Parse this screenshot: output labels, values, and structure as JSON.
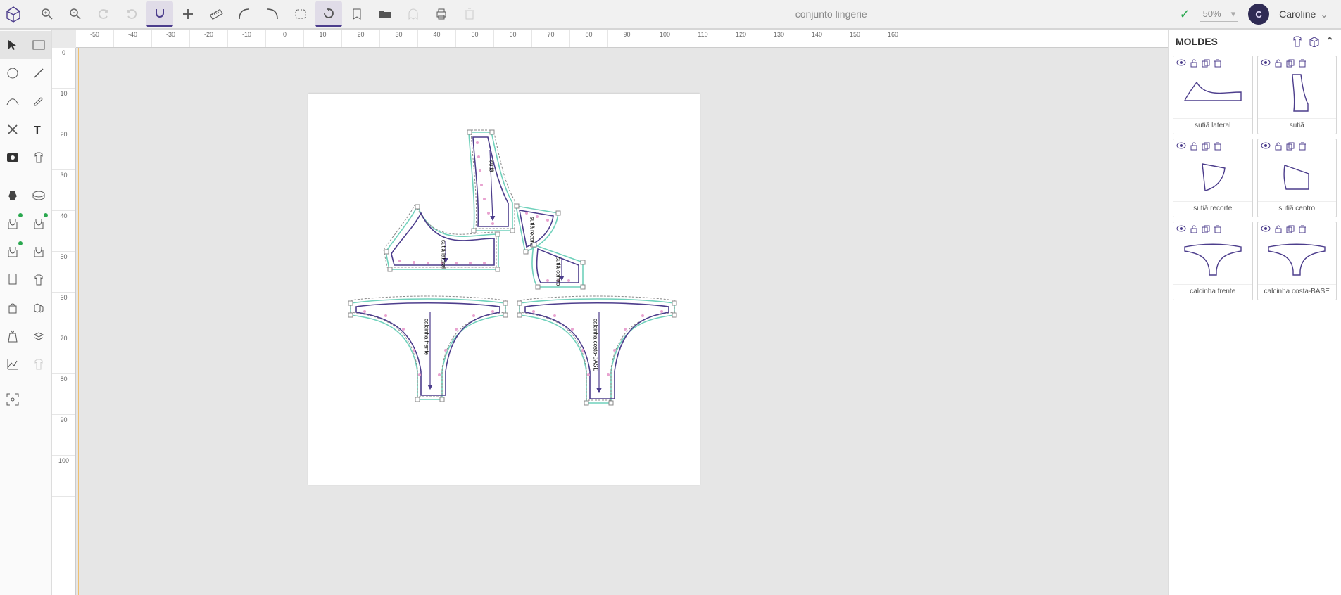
{
  "header": {
    "title": "conjunto lingerie",
    "zoom": "50%",
    "userInitial": "C",
    "userName": "Caroline"
  },
  "rulerH": [
    "-50",
    "-40",
    "-30",
    "-20",
    "-10",
    "0",
    "10",
    "20",
    "30",
    "40",
    "50",
    "60",
    "70",
    "80",
    "90",
    "100",
    "110",
    "120",
    "130",
    "140",
    "150",
    "160"
  ],
  "rulerV": [
    "0",
    "10",
    "20",
    "30",
    "40",
    "50",
    "60",
    "70",
    "80",
    "90",
    "100"
  ],
  "sidebar": {
    "title": "MOLDES",
    "items": [
      {
        "label": "sutiã lateral"
      },
      {
        "label": "sutiã"
      },
      {
        "label": "sutiã recorte"
      },
      {
        "label": "sutiã centro"
      },
      {
        "label": "calcinha frente"
      },
      {
        "label": "calcinha costa-BASE"
      }
    ]
  },
  "pieces": {
    "p1_label": "sutiã lateral",
    "p2_label": "sutiã",
    "p3_label": "sutiã recorte",
    "p4_label": "sutiã centro",
    "p5_label": "calcinha frente",
    "p6_label": "calcinha costa-BASE"
  }
}
